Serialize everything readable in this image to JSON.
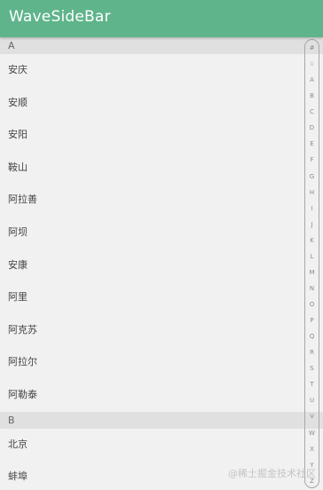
{
  "app_bar": {
    "title": "WaveSideBar",
    "color": "#5fb48b"
  },
  "sections": [
    {
      "header": "A",
      "items": [
        "安庆",
        "安顺",
        "安阳",
        "鞍山",
        "阿拉善",
        "阿坝",
        "安康",
        "阿里",
        "阿克苏",
        "阿拉尔",
        "阿勒泰"
      ]
    },
    {
      "header": "B",
      "items": [
        "北京",
        "蚌埠"
      ]
    }
  ],
  "side_bar": {
    "letters": [
      "#",
      "☆",
      "A",
      "B",
      "C",
      "D",
      "E",
      "F",
      "G",
      "H",
      "I",
      "J",
      "K",
      "L",
      "M",
      "N",
      "O",
      "P",
      "Q",
      "R",
      "S",
      "T",
      "U",
      "V",
      "W",
      "X",
      "Y",
      "Z"
    ]
  },
  "watermark": "@稀土掘金技术社区"
}
